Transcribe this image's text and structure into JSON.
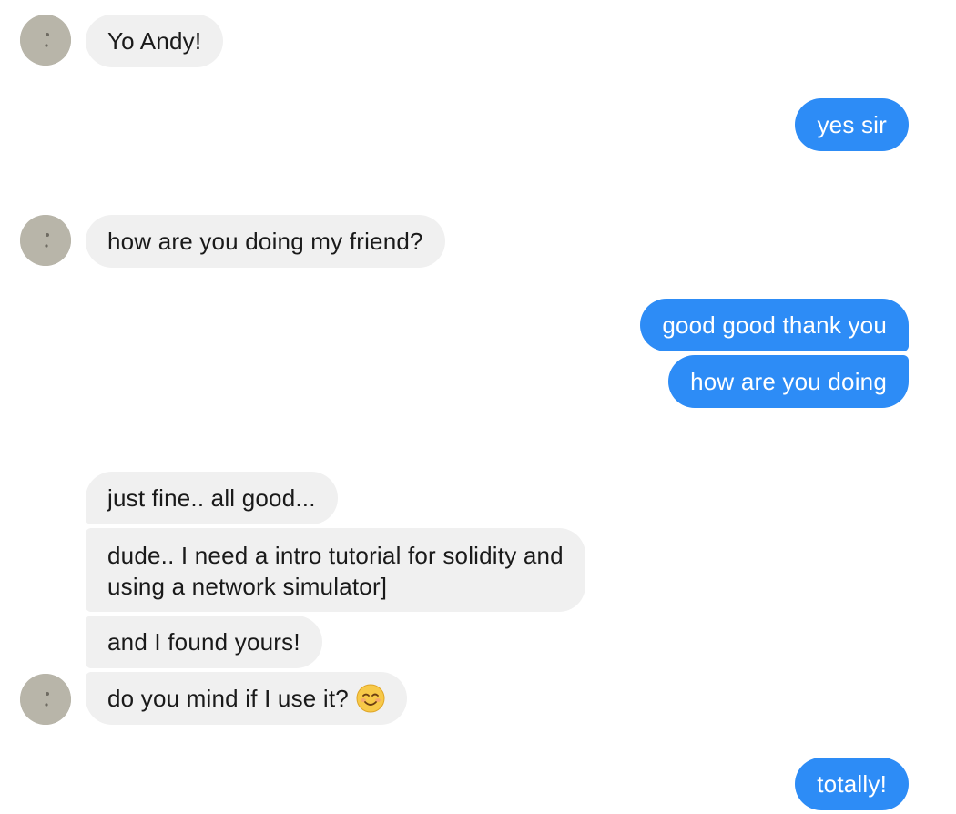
{
  "conversation": {
    "messages": [
      {
        "direction": "incoming",
        "text": "Yo Andy!"
      },
      {
        "direction": "outgoing",
        "text": "yes sir"
      },
      {
        "direction": "incoming",
        "text": "how are you doing my friend?"
      },
      {
        "direction": "outgoing",
        "text": "good good thank you"
      },
      {
        "direction": "outgoing",
        "text": "how are you doing"
      },
      {
        "direction": "incoming",
        "text": "just fine.. all good..."
      },
      {
        "direction": "incoming",
        "line1": "dude.. I need a intro tutorial for solidity and",
        "line2": "using a network simulator]"
      },
      {
        "direction": "incoming",
        "text": "and I found yours!"
      },
      {
        "direction": "incoming",
        "text": "do you mind if I use it?",
        "emoji": "smiling-face-emoji"
      },
      {
        "direction": "outgoing",
        "text": "totally!"
      }
    ]
  },
  "colors": {
    "incoming_bubble": "#f0f0f0",
    "outgoing_bubble": "#2d8cf6",
    "incoming_text": "#1a1a1a",
    "outgoing_text": "#ffffff"
  },
  "icons": {
    "avatar": "contact-avatar",
    "emoji": "smiling-face-emoji"
  }
}
